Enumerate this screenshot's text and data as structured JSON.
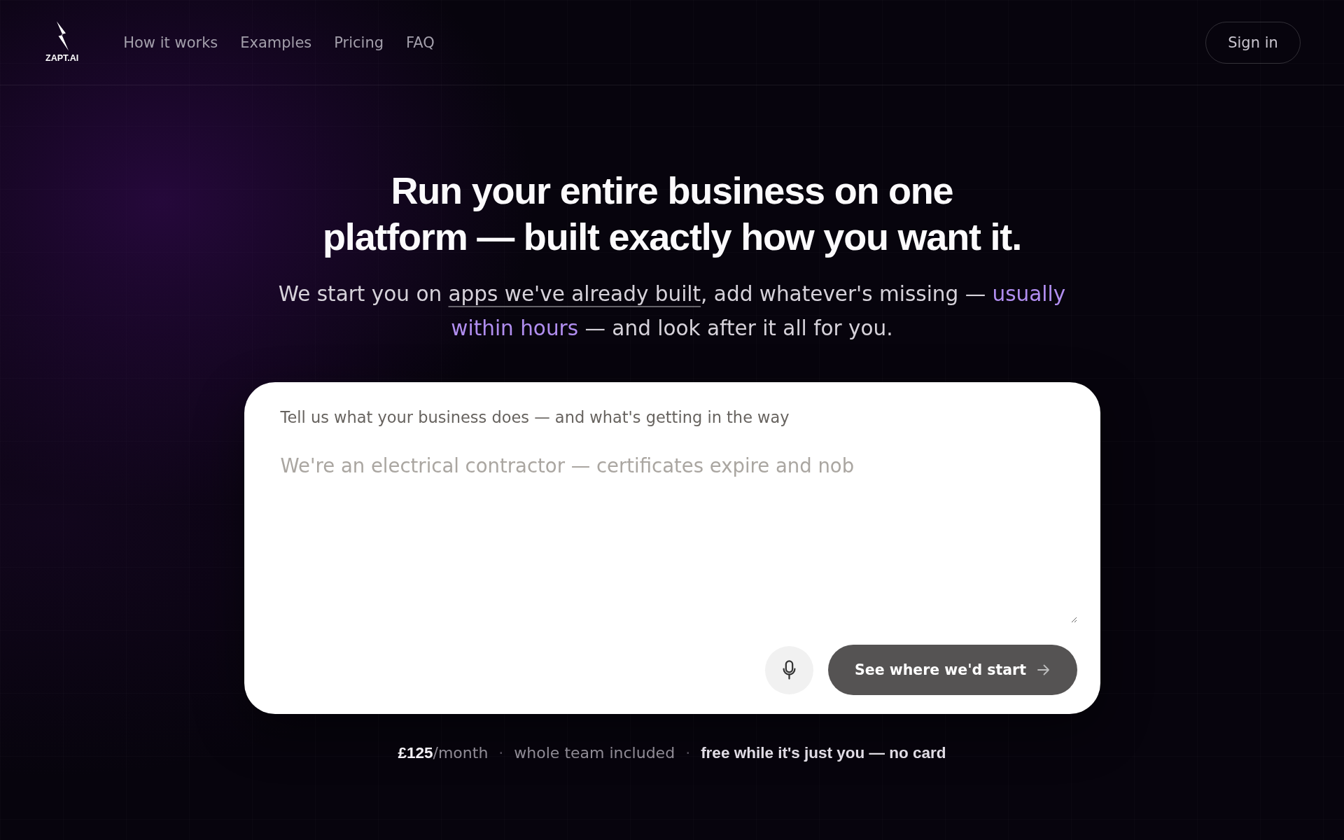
{
  "header": {
    "logo": {
      "text": "ZAPT.AI"
    },
    "nav": [
      {
        "label": "How it works"
      },
      {
        "label": "Examples"
      },
      {
        "label": "Pricing"
      },
      {
        "label": "FAQ"
      }
    ],
    "sign_in": {
      "label": "Sign in"
    }
  },
  "hero": {
    "title": "Run your entire business on one platform — built exactly how you want it.",
    "subtitle": [
      {
        "kind": "plain",
        "text": "We start you on "
      },
      {
        "kind": "link",
        "text": "apps we've already built"
      },
      {
        "kind": "plain",
        "text": ", add whatever's missing — "
      },
      {
        "kind": "highlight",
        "text": "usually within hours"
      },
      {
        "kind": "plain",
        "text": " — and look after it all for you."
      }
    ]
  },
  "prompt_card": {
    "label": "Tell us what your business does — and what's getting in the way",
    "textarea": {
      "placeholder": "We're an electrical contractor — certificates expire and nob"
    },
    "buttons": [
      {
        "kind": "mic"
      },
      {
        "kind": "submit",
        "label": "See where we'd start"
      }
    ]
  },
  "pricing_note": [
    {
      "kind": "price",
      "text": "**£125**/month"
    },
    {
      "kind": "separator",
      "text": "·"
    },
    {
      "kind": "plain",
      "text": "whole team included"
    },
    {
      "kind": "separator",
      "text": "·"
    },
    {
      "kind": "emphasis",
      "text": "free while it's just you — no card"
    }
  ]
}
